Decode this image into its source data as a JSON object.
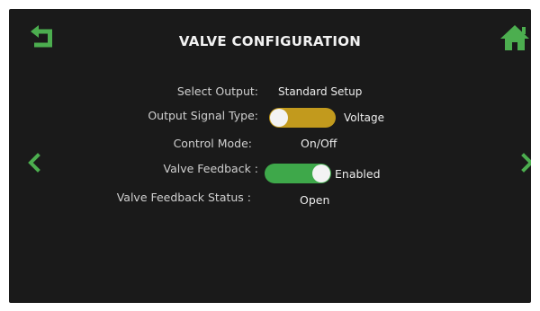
{
  "header": {
    "title": "VALVE CONFIGURATION",
    "back_icon": "back-arrow-icon",
    "home_icon": "home-icon"
  },
  "nav": {
    "prev_icon": "chevron-left-icon",
    "next_icon": "chevron-right-icon"
  },
  "settings": {
    "select_output": {
      "label": "Select Output:",
      "value": "Standard Setup"
    },
    "output_signal_type": {
      "label": "Output Signal Type:",
      "value": "Voltage",
      "toggle_state": "off",
      "toggle_color": "#c29a1d"
    },
    "control_mode": {
      "label": "Control Mode:",
      "value": "On/Off"
    },
    "valve_feedback": {
      "label": "Valve Feedback :",
      "value": "Enabled",
      "toggle_state": "on",
      "toggle_color": "#3ea84a"
    },
    "valve_feedback_status": {
      "label": "Valve Feedback Status :",
      "value": "Open"
    }
  },
  "colors": {
    "accent_green": "#3ea84a",
    "accent_amber": "#c29a1d",
    "background": "#1a1a1a"
  }
}
